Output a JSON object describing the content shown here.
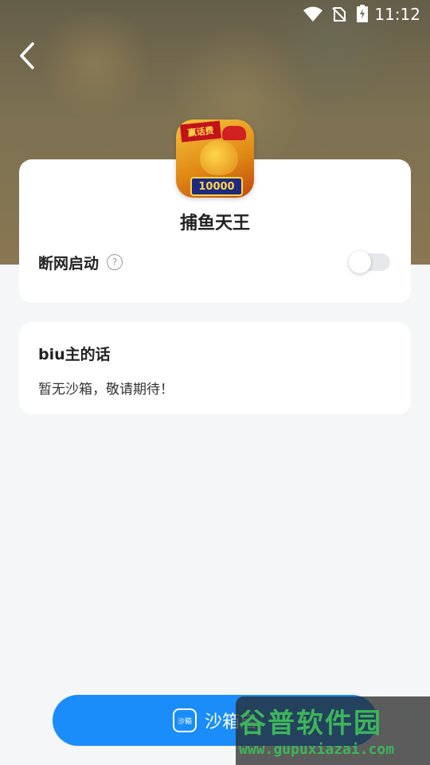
{
  "status_bar": {
    "time": "11:12"
  },
  "app": {
    "name": "捕鱼天王",
    "icon_banner": "赢话费",
    "icon_badge": "10000"
  },
  "settings": {
    "offline_launch_label": "断网启动",
    "help_glyph": "?",
    "offline_launch_enabled": false
  },
  "message": {
    "title": "biu主的话",
    "body": "暂无沙箱，敬请期待！"
  },
  "action": {
    "icon_text": "沙箱",
    "start_label": "沙箱启"
  },
  "watermark": {
    "title": "谷普软件园",
    "url": "www.gupuxiazai.com"
  },
  "colors": {
    "accent": "#1a8dfa",
    "page_bg": "#f5f6f8",
    "card_bg": "#ffffff",
    "watermark_green": "#3db55a"
  }
}
